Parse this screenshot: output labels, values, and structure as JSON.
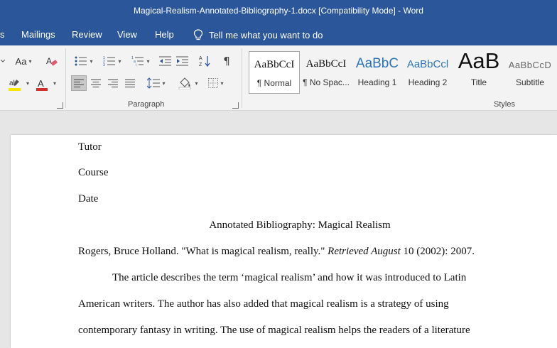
{
  "window": {
    "title": "Magical-Realism-Annotated-Bibliography-1.docx [Compatibility Mode]  -  Word"
  },
  "menu": {
    "tabs": [
      {
        "label": "s"
      },
      {
        "label": "Mailings"
      },
      {
        "label": "Review"
      },
      {
        "label": "View"
      },
      {
        "label": "Help"
      }
    ],
    "tell_me": "Tell me what you want to do"
  },
  "ribbon": {
    "paragraph_label": "Paragraph",
    "styles_label": "Styles",
    "font_case_glyph": "Aa",
    "styles": [
      {
        "sample": "AaBbCcI",
        "label": "¶ Normal"
      },
      {
        "sample": "AaBbCcI",
        "label": "¶ No Spac..."
      },
      {
        "sample": "AaBbC",
        "label": "Heading 1"
      },
      {
        "sample": "AaBbCcl",
        "label": "Heading 2"
      },
      {
        "sample": "AaB",
        "label": "Title"
      },
      {
        "sample": "AaBbCcD",
        "label": "Subtitle"
      }
    ],
    "colors": {
      "highlight": "#f7e600",
      "font_color": "#d0312d",
      "accent": "#2b579a"
    }
  },
  "document": {
    "lines": {
      "tutor": "Tutor",
      "course": "Course",
      "date": "Date",
      "heading": "Annotated Bibliography: Magical Realism",
      "citation_pre": "Rogers, Bruce Holland. \"What is magical realism, really.\" ",
      "citation_italic": "Retrieved August",
      "citation_post": " 10 (2002): 2007.",
      "para1": "The article describes the term ‘magical realism’ and how it was introduced to Latin",
      "para2": "American writers. The author has also added that magical realism is a strategy of using",
      "para3": "contemporary fantasy in writing. The use of magical realism helps the readers of a literature"
    }
  }
}
